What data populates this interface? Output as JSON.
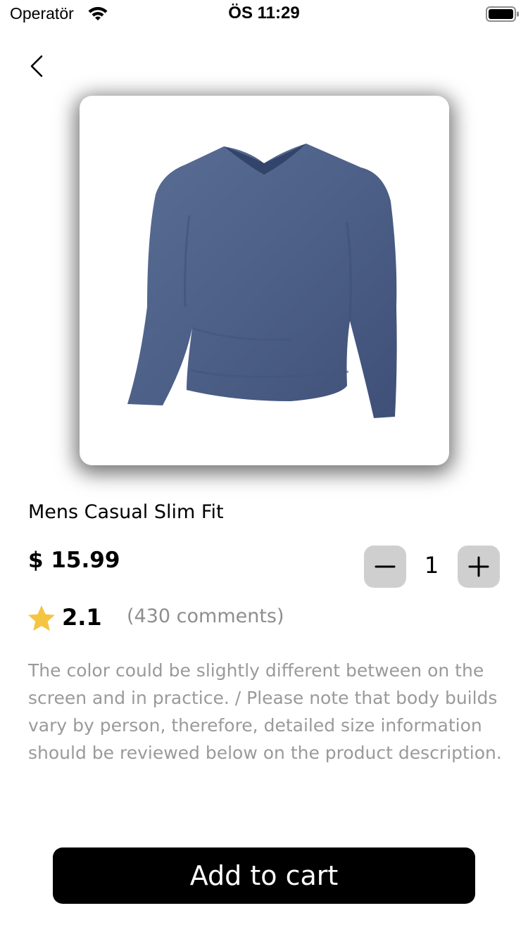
{
  "status_bar": {
    "carrier": "Operatör",
    "time": "ÖS 11:29",
    "wifi_icon": "wifi-icon",
    "battery_icon": "battery-icon"
  },
  "navigation": {
    "back_icon": "chevron-left-icon"
  },
  "product": {
    "image_subject": "blue long sleeve v-neck t-shirt",
    "title": "Mens Casual Slim Fit",
    "price": "$ 15.99",
    "rating": "2.1",
    "comments": "(430 comments)",
    "description": "The color could be slightly different between on the screen and in practice. / Please note that body builds vary by person, therefore, detailed size information should be reviewed below on the product description."
  },
  "quantity": {
    "value": "1",
    "minus_icon": "minus-icon",
    "plus_icon": "plus-icon"
  },
  "actions": {
    "add_to_cart_label": "Add to cart"
  },
  "colors": {
    "accent": "#000000",
    "star": "#F5C542",
    "stepper_bg": "#CFCFCF",
    "muted_text": "#9A9A9A",
    "shirt": "#4D6088"
  }
}
